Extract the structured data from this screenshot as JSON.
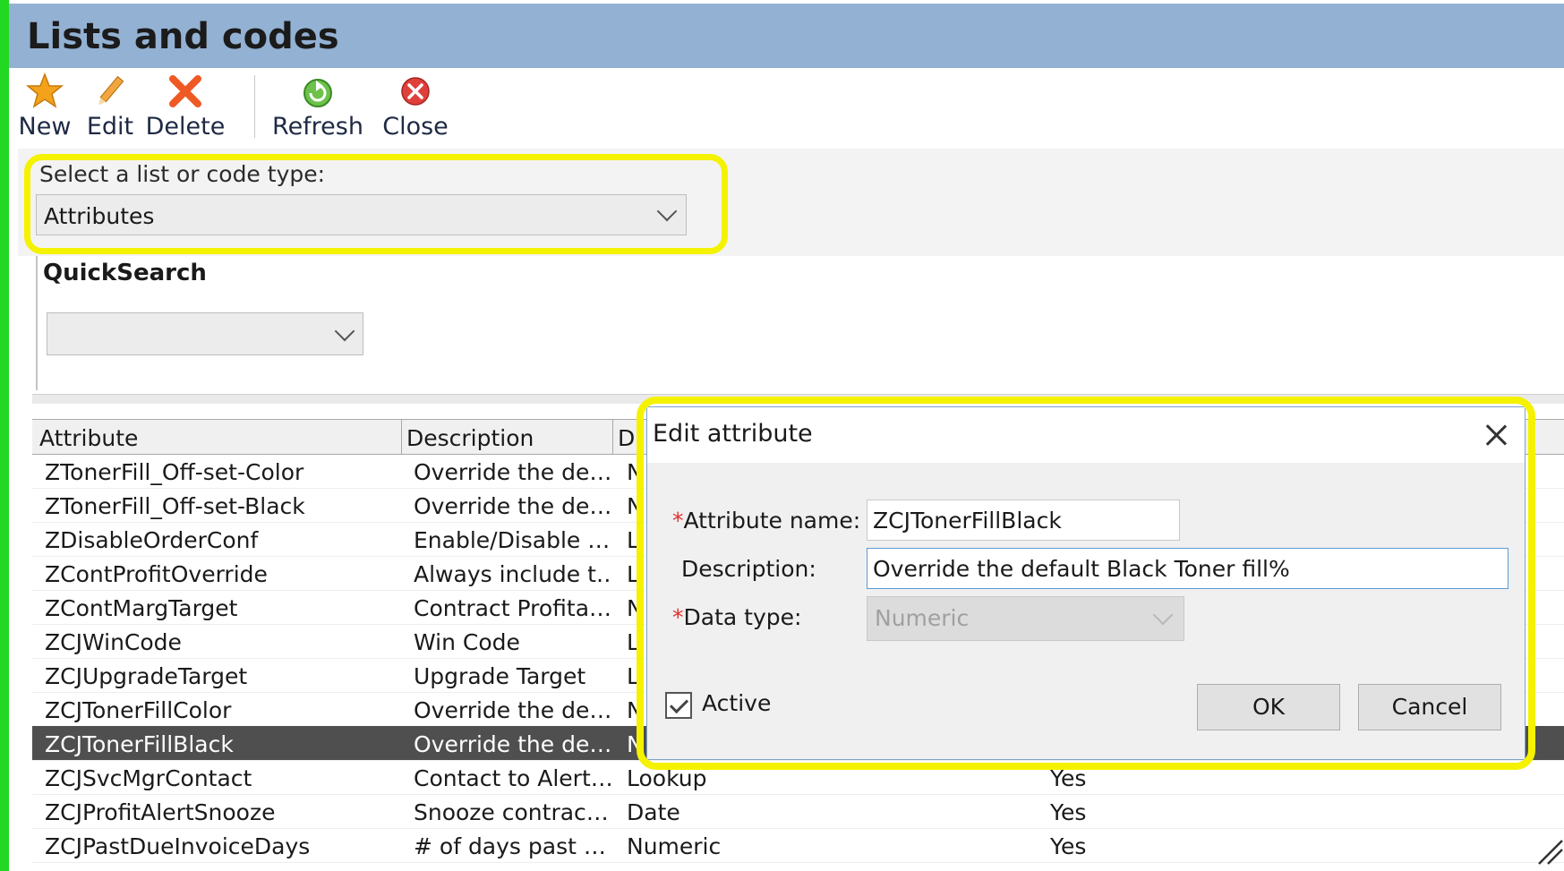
{
  "window": {
    "title": "Lists and codes"
  },
  "toolbar": {
    "new_label": "New",
    "edit_label": "Edit",
    "delete_label": "Delete",
    "refresh_label": "Refresh",
    "close_label": "Close"
  },
  "selector": {
    "label": "Select a list or code type:",
    "value": "Attributes"
  },
  "quicksearch": {
    "label": "QuickSearch",
    "value": ""
  },
  "grid": {
    "columns": [
      "Attribute",
      "Description",
      "D"
    ],
    "rows": [
      {
        "attribute": "ZTonerFill_Off-set-Color",
        "description": "Override the de…",
        "datatype": "N",
        "active": ""
      },
      {
        "attribute": "ZTonerFill_Off-set-Black",
        "description": "Override the de…",
        "datatype": "N",
        "active": ""
      },
      {
        "attribute": "ZDisableOrderConf",
        "description": "Enable/Disable …",
        "datatype": "L",
        "active": ""
      },
      {
        "attribute": "ZContProfitOverride",
        "description": "Always include t…",
        "datatype": "L",
        "active": ""
      },
      {
        "attribute": "ZContMargTarget",
        "description": "Contract Profita…",
        "datatype": "N",
        "active": ""
      },
      {
        "attribute": "ZCJWinCode",
        "description": "Win Code",
        "datatype": "L",
        "active": ""
      },
      {
        "attribute": "ZCJUpgradeTarget",
        "description": "Upgrade Target",
        "datatype": "L",
        "active": ""
      },
      {
        "attribute": "ZCJTonerFillColor",
        "description": "Override the de…",
        "datatype": "N",
        "active": ""
      },
      {
        "attribute": "ZCJTonerFillBlack",
        "description": "Override the de…",
        "datatype": "N",
        "active": "",
        "selected": true
      },
      {
        "attribute": "ZCJSvcMgrContact",
        "description": "Contact to Alert…",
        "datatype": "Lookup",
        "active": "Yes"
      },
      {
        "attribute": "ZCJProfitAlertSnooze",
        "description": "Snooze contrac…",
        "datatype": "Date",
        "active": "Yes"
      },
      {
        "attribute": "ZCJPastDueInvoiceDays",
        "description": "# of days past …",
        "datatype": "Numeric",
        "active": "Yes"
      }
    ]
  },
  "dialog": {
    "title": "Edit attribute",
    "attribute_name_label": "Attribute name:",
    "attribute_name_value": "ZCJTonerFillBlack",
    "description_label": "Description:",
    "description_value": "Override the default Black Toner fill%",
    "data_type_label": "Data type:",
    "data_type_value": "Numeric",
    "required_marker": "*",
    "active_label": "Active",
    "active_checked": true,
    "ok_label": "OK",
    "cancel_label": "Cancel"
  },
  "colors": {
    "title_bar": "#93b1d3",
    "highlight": "#f5f200",
    "frame_green": "#22d822",
    "selected_row": "#4f4f4f"
  }
}
